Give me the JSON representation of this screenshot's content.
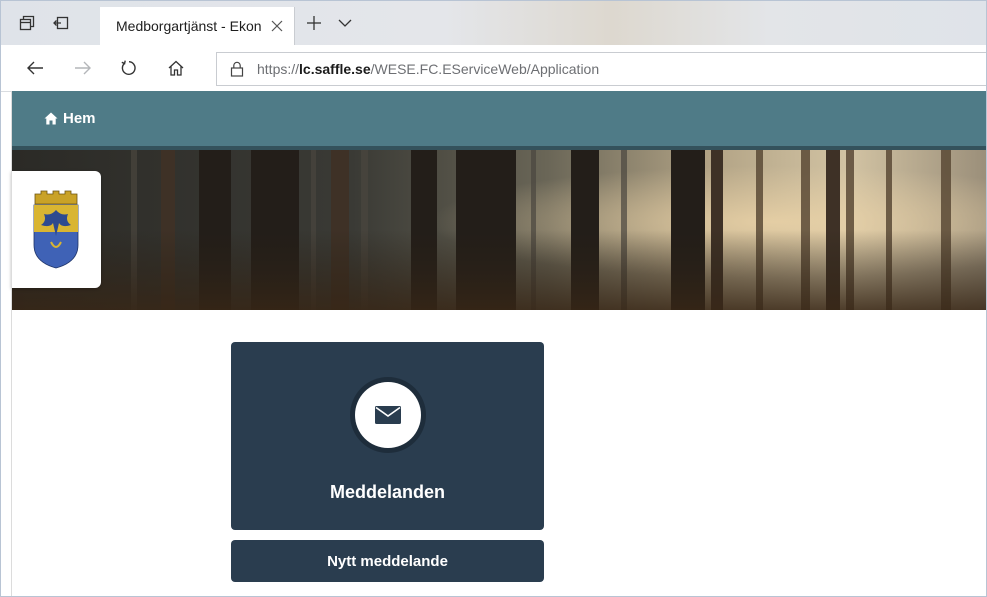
{
  "browser": {
    "tab": {
      "title": "Medborgartjänst - Ekon"
    },
    "address": {
      "scheme": "https://",
      "host": "lc.saffle.se",
      "path": "/WESE.FC.EServiceWeb/Application"
    },
    "icons": {
      "tab_actions": "tab-actions-icon",
      "set_aside": "set-aside-tabs-icon",
      "close": "close-icon",
      "new_tab": "plus-icon",
      "tab_list": "chevron-down-icon",
      "back": "back-arrow-icon",
      "forward": "forward-arrow-icon",
      "refresh": "refresh-icon",
      "home": "home-icon",
      "lock": "lock-icon"
    }
  },
  "site": {
    "nav": {
      "home_label": "Hem"
    },
    "colors": {
      "nav_bar": "#4f7b87",
      "card": "#2a3d4f"
    }
  },
  "main": {
    "messages_card": {
      "title": "Meddelanden",
      "icon": "envelope-icon"
    },
    "new_message_button": {
      "label": "Nytt meddelande"
    }
  }
}
